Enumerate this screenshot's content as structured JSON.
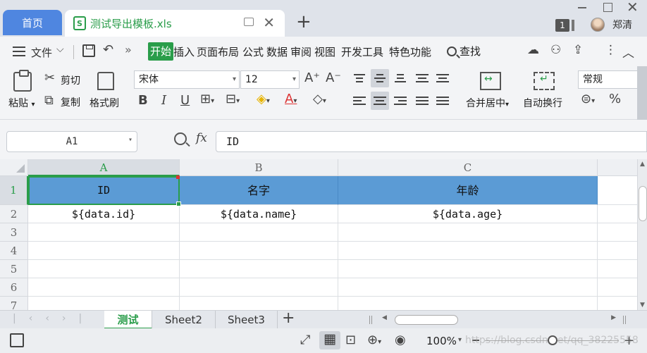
{
  "title_bar": {
    "home_tab": "首页",
    "doc_tab": {
      "icon": "S",
      "title": "测试导出模板.xls"
    },
    "new_tab_symbol": "+",
    "notification_count": "1",
    "username": "郑清"
  },
  "menu": {
    "file": "文件",
    "items": [
      "开始",
      "插入",
      "页面布局",
      "公式",
      "数据",
      "审阅",
      "视图",
      "开发工具",
      "特色功能"
    ],
    "active": "开始",
    "search": "查找"
  },
  "ribbon": {
    "paste": "粘贴",
    "cut": "剪切",
    "copy": "复制",
    "format_painter": "格式刷",
    "font_name": "宋体",
    "font_size": "12",
    "bold": "B",
    "italic": "I",
    "underline": "U",
    "merge_center": "合并居中",
    "wrap_text": "自动换行",
    "number_format": "常规",
    "percent": "%"
  },
  "formula_bar": {
    "name_box": "A1",
    "fx": "fx",
    "content": "ID"
  },
  "sheet": {
    "columns": [
      "A",
      "B",
      "C"
    ],
    "selected_column": "A",
    "rows": [
      "1",
      "2",
      "3",
      "4",
      "5",
      "6",
      "7"
    ],
    "selected_row": "1",
    "cells": {
      "r1": [
        "ID",
        "名字",
        "年龄"
      ],
      "r2": [
        "${data.id}",
        "${data.name}",
        "${data.age}"
      ]
    },
    "header_fill": "#5b9bd5"
  },
  "sheet_tabs": {
    "tabs": [
      "测试",
      "Sheet2",
      "Sheet3"
    ],
    "active": "测试",
    "add": "+"
  },
  "status_bar": {
    "zoom": "100%",
    "watermark": "https://blog.csdn.net/qq_38225558"
  },
  "colors": {
    "accent_green": "#2a9d4a",
    "home_tab_blue": "#4f86e0"
  }
}
